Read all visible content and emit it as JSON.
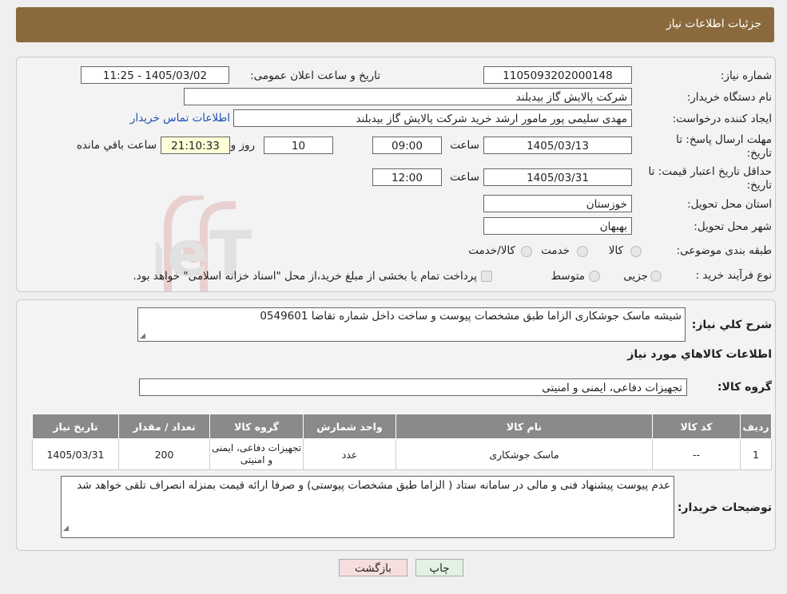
{
  "header": {
    "title": "جزئیات اطلاعات نیاز"
  },
  "form": {
    "need_number_label": "شماره نیاز:",
    "need_number": "1105093202000148",
    "announce_label": "تاریخ و ساعت اعلان عمومی:",
    "announce_value": "1405/03/02 - 11:25",
    "buyer_org_label": "نام دستگاه خریدار:",
    "buyer_org": "شرکت پالایش گاز بیدبلند",
    "requester_label": "ایجاد کننده درخواست:",
    "requester": "مهدی سلیمی پور مامور ارشد خرید شرکت پالایش گاز بیدبلند",
    "contact_link": "اطلاعات تماس خریدار",
    "deadline_label_1": "مهلت ارسال پاسخ: تا",
    "deadline_label_2": "تاریخ:",
    "deadline_date": "1405/03/13",
    "time_label": "ساعت",
    "deadline_time": "09:00",
    "days_value": "10",
    "days_label": "روز و",
    "remaining_time": "21:10:33",
    "remaining_label": "ساعت باقي مانده",
    "validity_label_1": "حداقل تاریخ اعتبار قیمت: تا",
    "validity_label_2": "تاریخ:",
    "validity_date": "1405/03/31",
    "validity_time": "12:00",
    "province_label": "استان محل تحویل:",
    "province": "خوزستان",
    "city_label": "شهر محل تحویل:",
    "city": "بهبهان",
    "category_label": "طبقه بندی موضوعی:",
    "category_options": [
      "کالا",
      "خدمت",
      "کالا/خدمت"
    ],
    "process_label": "نوع فرآیند خرید :",
    "process_options": [
      "جزیی",
      "متوسط"
    ],
    "process_note": "پرداخت تمام یا بخشی از مبلغ خرید،از محل \"اسناد خزانه اسلامی\" خواهد بود."
  },
  "watermark": {
    "text": "AriaTender.neT"
  },
  "summary": {
    "label": "شرح کلي نياز:",
    "value": "شیشه ماسک جوشکاری الزاما  طبق مشخصات پیوست  و ساخت داخل شماره تقاضا 0549601",
    "goods_info_title": "اطلاعات کالاهاي مورد نياز",
    "group_label": "گروه کالا:",
    "group_value": "تجهیزات دفاعی، ایمنی و امنیتی"
  },
  "table": {
    "headers": [
      "ردیف",
      "کد کالا",
      "نام کالا",
      "واحد شمارش",
      "گروه کالا",
      "تعداد / مقدار",
      "تاریخ نیاز"
    ],
    "rows": [
      [
        "1",
        "--",
        "ماسک جوشکاری",
        "عدد",
        "تجهیزات دفاعی، ایمنی و امنیتی",
        "200",
        "1405/03/31"
      ]
    ]
  },
  "buyer_notes": {
    "label": "توضیحات خریدار:",
    "value": "عدم پیوست پیشنهاد فنی و مالی در سامانه ستاد ( الزاما طبق مشخصات پیوستی)  و صرفا ارائه قیمت بمنزله انصراف تلقی خواهد شد"
  },
  "buttons": {
    "print": "چاپ",
    "back": "بازگشت"
  },
  "colors": {
    "header": "#8a6a3c",
    "table_header": "#8a8a8a",
    "back_button": "#f7dede",
    "print_button": "#e2f2e2",
    "link": "#1a4fb5"
  }
}
